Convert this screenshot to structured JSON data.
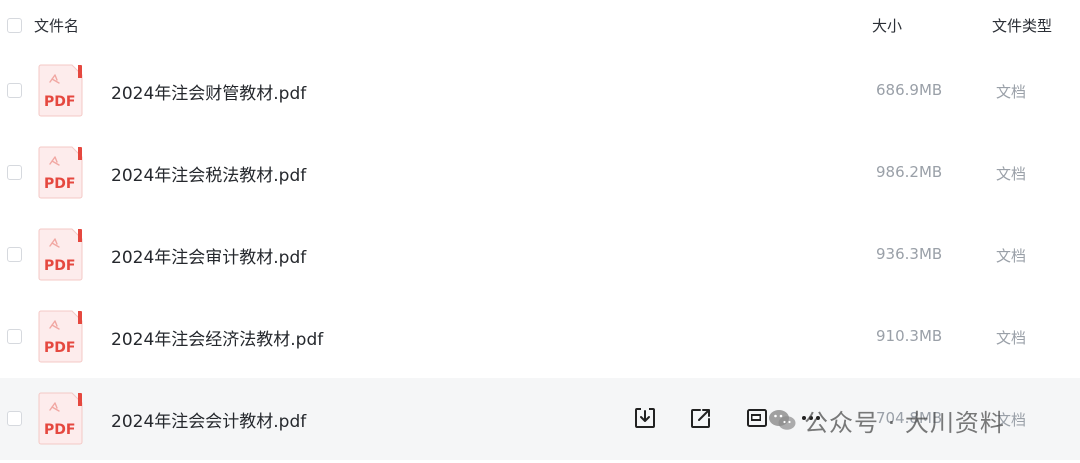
{
  "header": {
    "name_label": "文件名",
    "size_label": "大小",
    "type_label": "文件类型"
  },
  "files": [
    {
      "name": "2024年注会财管教材.pdf",
      "size": "686.9MB",
      "type": "文档",
      "icon": "pdf-icon",
      "icon_label": "PDF"
    },
    {
      "name": "2024年注会税法教材.pdf",
      "size": "986.2MB",
      "type": "文档",
      "icon": "pdf-icon",
      "icon_label": "PDF"
    },
    {
      "name": "2024年注会审计教材.pdf",
      "size": "936.3MB",
      "type": "文档",
      "icon": "pdf-icon",
      "icon_label": "PDF"
    },
    {
      "name": "2024年注会经济法教材.pdf",
      "size": "910.3MB",
      "type": "文档",
      "icon": "pdf-icon",
      "icon_label": "PDF"
    },
    {
      "name": "2024年注会会计教材.pdf",
      "size": "704.8MB",
      "type": "文档",
      "icon": "pdf-icon",
      "icon_label": "PDF"
    }
  ],
  "row_actions": [
    {
      "icon": "download-icon"
    },
    {
      "icon": "share-icon"
    },
    {
      "icon": "preview-icon"
    },
    {
      "icon": "more-icon"
    }
  ],
  "watermark": {
    "text": "公众号 · 大川资料",
    "icon": "wechat-icon"
  },
  "colors": {
    "pdf_red": "#e5483f",
    "hover_row_bg": "#f5f6f7",
    "muted_text": "#9aa0a8"
  }
}
